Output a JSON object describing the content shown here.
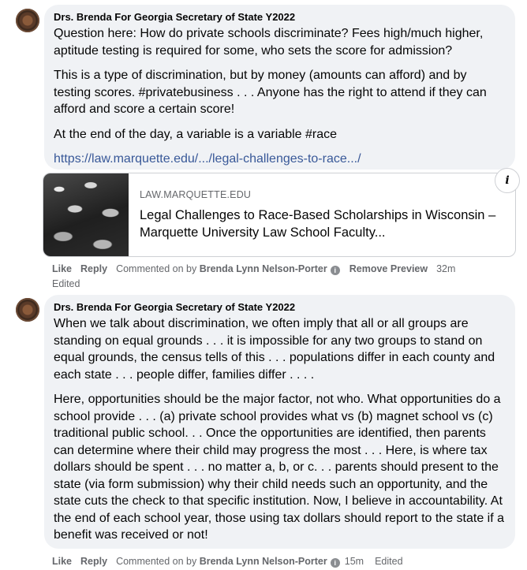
{
  "comments": [
    {
      "author": "Drs. Brenda For Georgia Secretary of State Y2022",
      "paragraphs": [
        "Question here: How do private schools discriminate? Fees high/much higher, aptitude testing is required for some, who sets the score for admission?",
        "This is a type of discrimination, but by money (amounts can afford) and by testing scores. #privatebusiness . . . Anyone has the right to attend if they can afford and score a certain score!",
        "At the end of the day, a variable is a variable #race"
      ],
      "link": "https://law.marquette.edu/.../legal-challenges-to-race.../",
      "preview": {
        "domain": "LAW.MARQUETTE.EDU",
        "title": "Legal Challenges to Race-Based Scholarships in Wisconsin – Marquette University Law School Faculty...",
        "info_label": "i"
      },
      "actions": {
        "like": "Like",
        "reply": "Reply",
        "commented_on_by": "Commented on by",
        "commenter": "Brenda Lynn Nelson-Porter",
        "remove_preview": "Remove Preview",
        "time": "32m",
        "edited": "Edited"
      }
    },
    {
      "author": "Drs. Brenda For Georgia Secretary of State Y2022",
      "paragraphs": [
        "When we talk about discrimination, we often imply that all or all groups are standing on equal grounds . . . it is impossible for any two groups to stand on equal grounds, the census tells of this . . . populations differ in each county and each state . . . people differ, families differ . . . .",
        "Here, opportunities should be the major factor, not who. What opportunities do a school provide . . . (a) private school provides what vs (b) magnet school vs (c) traditional public school. . . Once the opportunities are identified, then parents can determine where their child may progress the most . . . Here, is where tax dollars should be spent . . . no matter a, b, or c. . . parents should present to the state (via form submission) why their child needs such an opportunity, and the state cuts the check to that specific institution. Now, I believe in accountability. At the end of each school year, those using tax dollars should report to the state if a benefit was received or not!"
      ],
      "actions": {
        "like": "Like",
        "reply": "Reply",
        "commented_on_by": "Commented on by",
        "commenter": "Brenda Lynn Nelson-Porter",
        "time": "15m",
        "edited": "Edited"
      }
    }
  ],
  "icons": {
    "info": "i"
  },
  "colors": {
    "bubble": "#f0f2f5",
    "link": "#385898",
    "meta": "#65676b"
  }
}
